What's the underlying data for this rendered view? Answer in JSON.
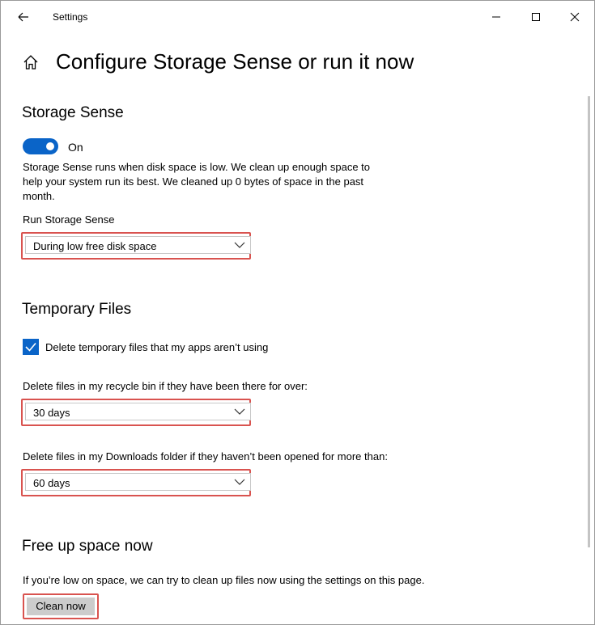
{
  "window": {
    "app_title": "Settings"
  },
  "page": {
    "title": "Configure Storage Sense or run it now"
  },
  "storage_sense": {
    "heading": "Storage Sense",
    "toggle_state": "On",
    "description": "Storage Sense runs when disk space is low. We clean up enough space to help your system run its best. We cleaned up 0 bytes of space in the past month.",
    "run_label": "Run Storage Sense",
    "run_value": "During low free disk space"
  },
  "temporary_files": {
    "heading": "Temporary Files",
    "checkbox_label": "Delete temporary files that my apps aren’t using",
    "recycle_label": "Delete files in my recycle bin if they have been there for over:",
    "recycle_value": "30 days",
    "downloads_label": "Delete files in my Downloads folder if they haven’t been opened for more than:",
    "downloads_value": "60 days"
  },
  "free_up": {
    "heading": "Free up space now",
    "description": "If you’re low on space, we can try to clean up files now using the settings on this page.",
    "button_label": "Clean now"
  },
  "colors": {
    "accent": "#0a64c8",
    "highlight": "#d9534f"
  }
}
